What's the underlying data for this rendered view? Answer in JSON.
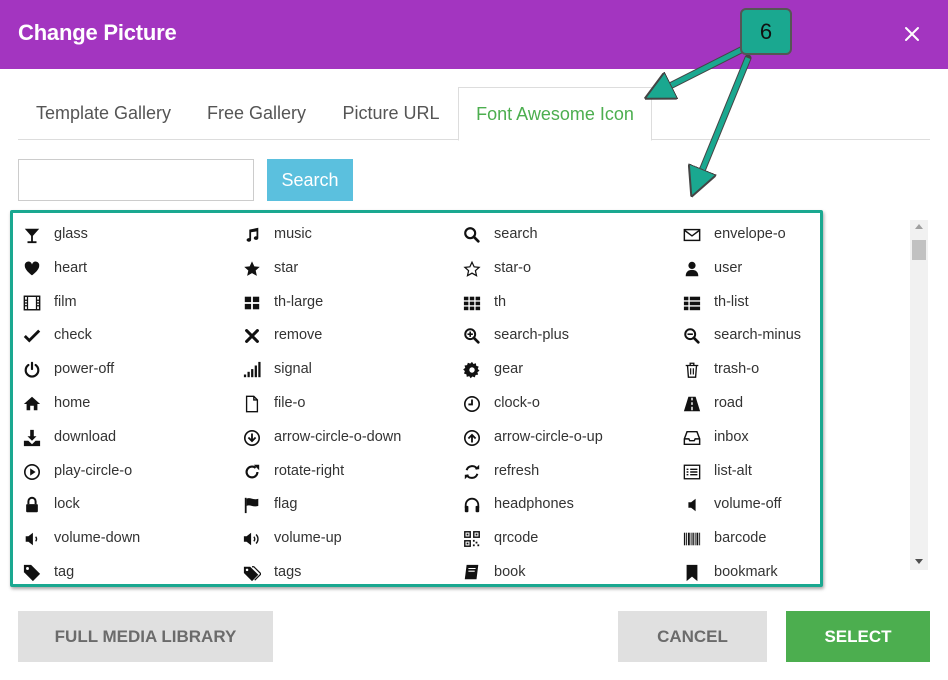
{
  "dialog": {
    "title": "Change Picture",
    "close_icon": "close-icon",
    "header_color": "#a335c0"
  },
  "tabs": [
    {
      "label": "Template Gallery",
      "active": false
    },
    {
      "label": "Free Gallery",
      "active": false
    },
    {
      "label": "Picture URL",
      "active": false
    },
    {
      "label": "Font Awesome Icon",
      "active": true
    }
  ],
  "search": {
    "value": "",
    "placeholder": "",
    "button_label": "Search",
    "button_color": "#5bc0de"
  },
  "icons": [
    {
      "name": "glass",
      "icon": "glass-icon"
    },
    {
      "name": "music",
      "icon": "music-icon"
    },
    {
      "name": "search",
      "icon": "search-icon"
    },
    {
      "name": "envelope-o",
      "icon": "envelope-o-icon"
    },
    {
      "name": "heart",
      "icon": "heart-icon"
    },
    {
      "name": "star",
      "icon": "star-icon"
    },
    {
      "name": "star-o",
      "icon": "star-o-icon"
    },
    {
      "name": "user",
      "icon": "user-icon"
    },
    {
      "name": "film",
      "icon": "film-icon"
    },
    {
      "name": "th-large",
      "icon": "th-large-icon"
    },
    {
      "name": "th",
      "icon": "th-icon"
    },
    {
      "name": "th-list",
      "icon": "th-list-icon"
    },
    {
      "name": "check",
      "icon": "check-icon"
    },
    {
      "name": "remove",
      "icon": "remove-icon"
    },
    {
      "name": "search-plus",
      "icon": "search-plus-icon"
    },
    {
      "name": "search-minus",
      "icon": "search-minus-icon"
    },
    {
      "name": "power-off",
      "icon": "power-off-icon"
    },
    {
      "name": "signal",
      "icon": "signal-icon"
    },
    {
      "name": "gear",
      "icon": "gear-icon"
    },
    {
      "name": "trash-o",
      "icon": "trash-o-icon"
    },
    {
      "name": "home",
      "icon": "home-icon"
    },
    {
      "name": "file-o",
      "icon": "file-o-icon"
    },
    {
      "name": "clock-o",
      "icon": "clock-o-icon"
    },
    {
      "name": "road",
      "icon": "road-icon"
    },
    {
      "name": "download",
      "icon": "download-icon"
    },
    {
      "name": "arrow-circle-o-down",
      "icon": "arrow-circle-o-down-icon"
    },
    {
      "name": "arrow-circle-o-up",
      "icon": "arrow-circle-o-up-icon"
    },
    {
      "name": "inbox",
      "icon": "inbox-icon"
    },
    {
      "name": "play-circle-o",
      "icon": "play-circle-o-icon"
    },
    {
      "name": "rotate-right",
      "icon": "rotate-right-icon"
    },
    {
      "name": "refresh",
      "icon": "refresh-icon"
    },
    {
      "name": "list-alt",
      "icon": "list-alt-icon"
    },
    {
      "name": "lock",
      "icon": "lock-icon"
    },
    {
      "name": "flag",
      "icon": "flag-icon"
    },
    {
      "name": "headphones",
      "icon": "headphones-icon"
    },
    {
      "name": "volume-off",
      "icon": "volume-off-icon"
    },
    {
      "name": "volume-down",
      "icon": "volume-down-icon"
    },
    {
      "name": "volume-up",
      "icon": "volume-up-icon"
    },
    {
      "name": "qrcode",
      "icon": "qrcode-icon"
    },
    {
      "name": "barcode",
      "icon": "barcode-icon"
    },
    {
      "name": "tag",
      "icon": "tag-icon"
    },
    {
      "name": "tags",
      "icon": "tags-icon"
    },
    {
      "name": "book",
      "icon": "book-icon"
    },
    {
      "name": "bookmark",
      "icon": "bookmark-icon"
    }
  ],
  "footer": {
    "media_library_label": "FULL MEDIA LIBRARY",
    "cancel_label": "CANCEL",
    "select_label": "SELECT",
    "select_color": "#4cae4f"
  },
  "annotation": {
    "label": "6",
    "color": "#1aa890"
  }
}
